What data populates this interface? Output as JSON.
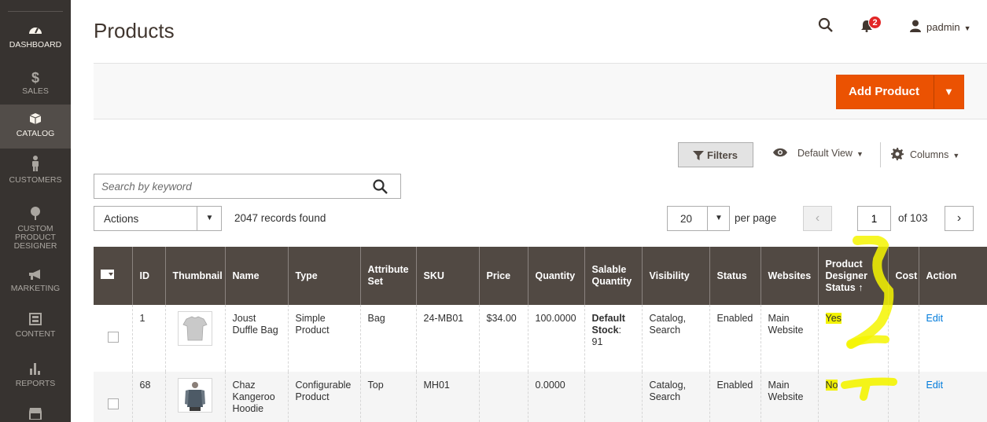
{
  "sidebar": {
    "items": [
      {
        "label": "DASHBOARD",
        "icon": "dashboard-icon"
      },
      {
        "label": "SALES",
        "icon": "dollar-icon"
      },
      {
        "label": "CATALOG",
        "icon": "box-icon"
      },
      {
        "label": "CUSTOMERS",
        "icon": "person-icon"
      },
      {
        "label": "CUSTOM PRODUCT DESIGNER",
        "icon": "tree-icon"
      },
      {
        "label": "MARKETING",
        "icon": "megaphone-icon"
      },
      {
        "label": "CONTENT",
        "icon": "layout-icon"
      },
      {
        "label": "REPORTS",
        "icon": "bar-chart-icon"
      },
      {
        "label": "",
        "icon": "store-icon"
      }
    ]
  },
  "header": {
    "title": "Products",
    "notifications_count": "2",
    "user": "padmin"
  },
  "action_bar": {
    "add_product_label": "Add Product"
  },
  "toolbar": {
    "filters_label": "Filters",
    "view_label": "Default View",
    "columns_label": "Columns",
    "search_placeholder": "Search by keyword",
    "actions_label": "Actions",
    "records_found": "2047 records found",
    "per_page_value": "20",
    "per_page_label": "per page",
    "page_value": "1",
    "page_of": "of 103"
  },
  "grid": {
    "columns": [
      "ID",
      "Thumbnail",
      "Name",
      "Type",
      "Attribute Set",
      "SKU",
      "Price",
      "Quantity",
      "Salable Quantity",
      "Visibility",
      "Status",
      "Websites",
      "Product Designer Status",
      "Cost",
      "Action"
    ],
    "rows": [
      {
        "id": "1",
        "name": "Joust Duffle Bag",
        "type": "Simple Product",
        "attribute_set": "Bag",
        "sku": "24-MB01",
        "price": "$34.00",
        "quantity": "100.0000",
        "salable_label": "Default Stock",
        "salable_value": ": 91",
        "visibility": "Catalog, Search",
        "status": "Enabled",
        "websites": "Main Website",
        "designer_status": "Yes",
        "cost": "",
        "action": "Edit"
      },
      {
        "id": "68",
        "name": "Chaz Kangeroo Hoodie",
        "type": "Configurable Product",
        "attribute_set": "Top",
        "sku": "MH01",
        "price": "",
        "quantity": "0.0000",
        "salable_label": "",
        "salable_value": "",
        "visibility": "Catalog, Search",
        "status": "Enabled",
        "websites": "Main Website",
        "designer_status": "No",
        "cost": "",
        "action": "Edit"
      }
    ]
  },
  "colors": {
    "sidebar_bg": "#373330",
    "accent": "#eb5202",
    "grid_header": "#514943",
    "highlight": "#f4f400",
    "link": "#007bdb"
  }
}
